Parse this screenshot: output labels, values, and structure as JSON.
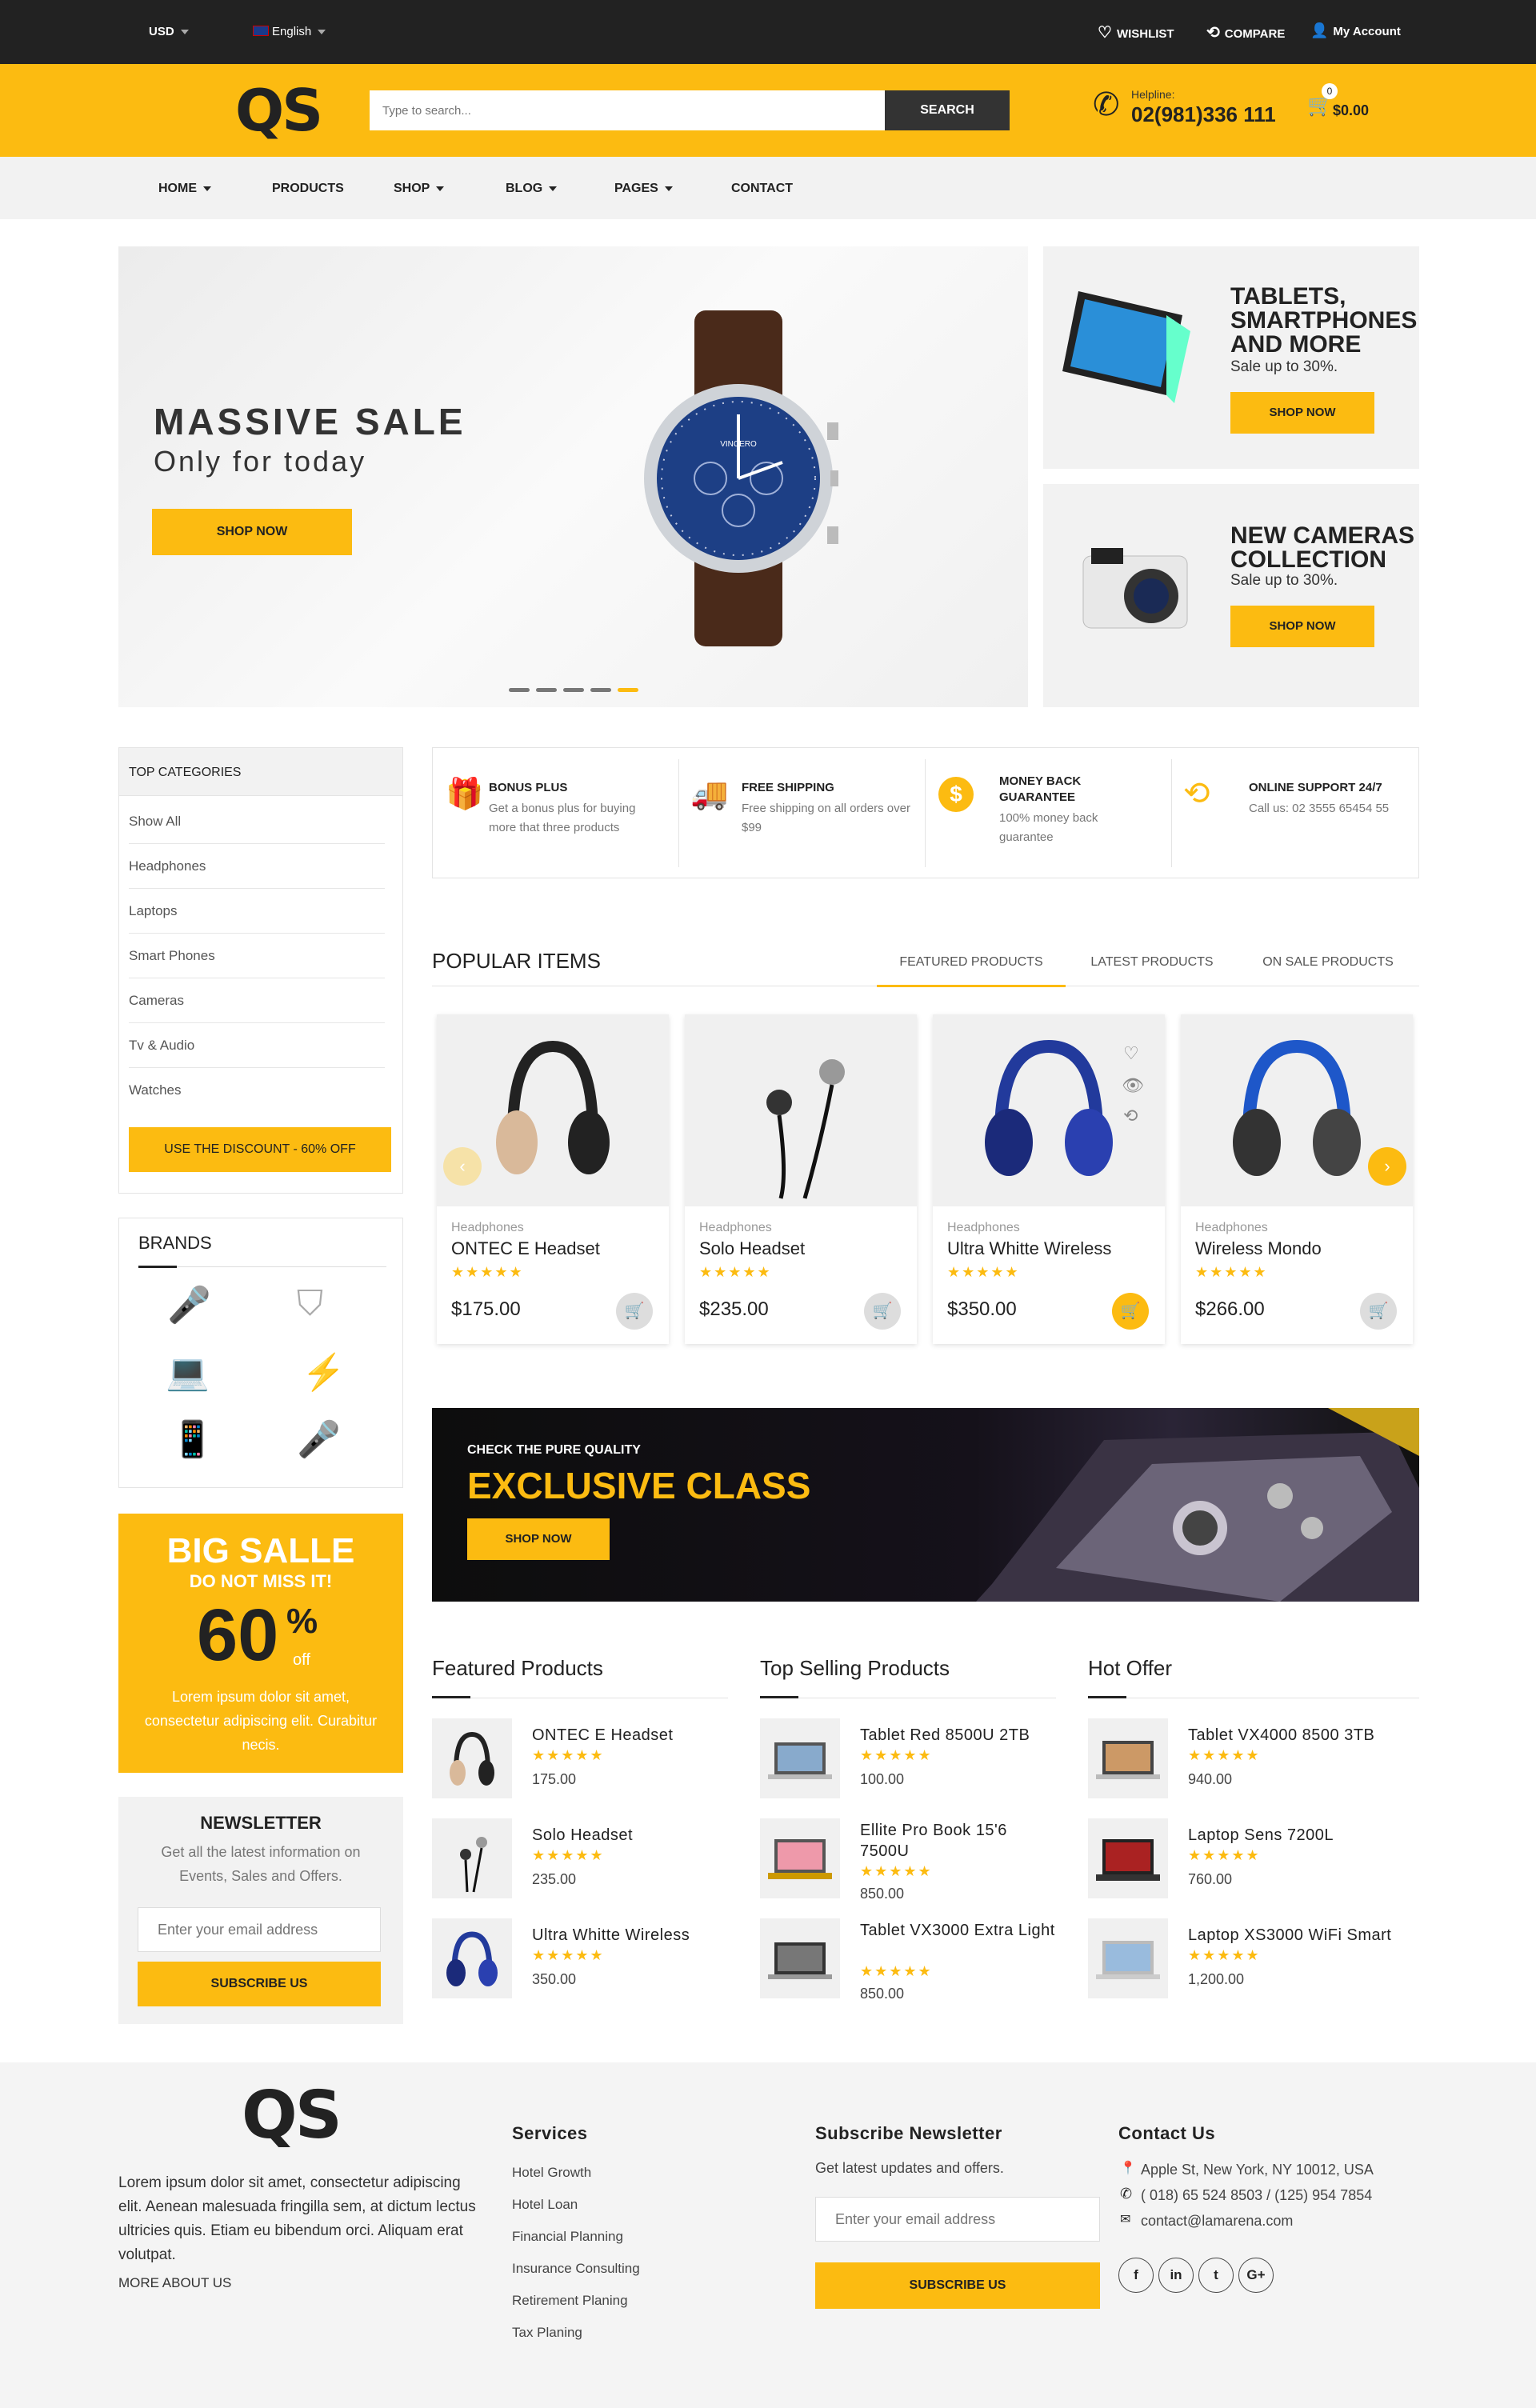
{
  "topbar": {
    "currency": "USD",
    "language": "English",
    "wishlist": "WISHLIST",
    "compare": "COMPARE",
    "account": "My Account"
  },
  "header": {
    "logo": "QS",
    "search_placeholder": "Type to search...",
    "search_button": "SEARCH",
    "helpline_label": "Helpline:",
    "helpline_number": "02(981)336 111",
    "cart_count": "0",
    "cart_total": "$0.00"
  },
  "nav": [
    "HOME",
    "PRODUCTS",
    "SHOP",
    "BLOG",
    "PAGES",
    "CONTACT"
  ],
  "hero": {
    "title": "MASSIVE SALE",
    "subtitle": "Only for today",
    "button": "SHOP NOW",
    "watch_brand": "VINCERO"
  },
  "side_banners": [
    {
      "title": "TABLETS, SMARTPHONES AND MORE",
      "sub": "Sale up to 30%.",
      "button": "SHOP NOW"
    },
    {
      "title": "NEW CAMERAS COLLECTION",
      "sub": "Sale up to 30%.",
      "button": "SHOP NOW"
    }
  ],
  "categories": {
    "title": "TOP CATEGORIES",
    "items": [
      "Show All",
      "Headphones",
      "Laptops",
      "Smart Phones",
      "Cameras",
      "Tv & Audio",
      "Watches"
    ],
    "button": "USE THE DISCOUNT - 60% OFF"
  },
  "brands": {
    "title": "BRANDS"
  },
  "features": [
    {
      "title": "BONUS PLUS",
      "desc": "Get a bonus plus for buying more that three products"
    },
    {
      "title": "FREE SHIPPING",
      "desc": "Free shipping on all orders over $99"
    },
    {
      "title": "MONEY BACK GUARANTEE",
      "desc": "100% money back guarantee"
    },
    {
      "title": "ONLINE SUPPORT 24/7",
      "desc": "Call us: 02 3555 65454 55"
    }
  ],
  "popular": {
    "title": "POPULAR ITEMS",
    "tabs": [
      "FEATURED PRODUCTS",
      "LATEST PRODUCTS",
      "ON SALE PRODUCTS"
    ],
    "products": [
      {
        "cat": "Headphones",
        "name": "ONTEC E Headset",
        "stars": "★★★★★",
        "price": "$175.00"
      },
      {
        "cat": "Headphones",
        "name": "Solo Headset",
        "stars": "★★★★★",
        "price": "$235.00"
      },
      {
        "cat": "Headphones",
        "name": "Ultra Whitte Wireless",
        "stars": "★★★★★",
        "price": "$350.00"
      },
      {
        "cat": "Headphones",
        "name": "Wireless Mondo",
        "stars": "★★★★★",
        "price": "$266.00"
      }
    ]
  },
  "promo": {
    "kicker": "CHECK THE PURE QUALITY",
    "title": "EXCLUSIVE CLASS",
    "button": "SHOP NOW"
  },
  "big_sale": {
    "title": "BIG SALLE",
    "sub": "DO NOT MISS IT!",
    "percent": "60",
    "pct": "%",
    "off": "off",
    "text": "Lorem ipsum dolor sit amet, consectetur adipiscing elit. Curabitur necis."
  },
  "newsletter_side": {
    "title": "NEWSLETTER",
    "text": "Get all the latest information on Events, Sales and Offers.",
    "placeholder": "Enter your email address",
    "button": "SUBSCRIBE US"
  },
  "lists": [
    {
      "title": "Featured Products",
      "items": [
        {
          "name": "ONTEC E Headset",
          "stars": "★★★★★",
          "price": "175.00"
        },
        {
          "name": "Solo Headset",
          "stars": "★★★★★",
          "price": "235.00"
        },
        {
          "name": "Ultra Whitte Wireless",
          "stars": "★★★★★",
          "price": "350.00"
        }
      ]
    },
    {
      "title": "Top Selling Products",
      "items": [
        {
          "name": "Tablet Red 8500U 2TB",
          "stars": "★★★★★",
          "price": "100.00"
        },
        {
          "name": "Ellite Pro Book 15'6 7500U",
          "stars": "★★★★★",
          "price": "850.00"
        },
        {
          "name": "Tablet VX3000 Extra Light",
          "stars": "★★★★★",
          "price": "850.00"
        }
      ]
    },
    {
      "title": "Hot Offer",
      "items": [
        {
          "name": "Tablet VX4000 8500 3TB",
          "stars": "★★★★★",
          "price": "940.00"
        },
        {
          "name": "Laptop Sens 7200L",
          "stars": "★★★★★",
          "price": "760.00"
        },
        {
          "name": "Laptop XS3000 WiFi Smart",
          "stars": "★★★★★",
          "price": "1,200.00"
        }
      ]
    }
  ],
  "footer": {
    "logo": "QS",
    "about": "Lorem ipsum dolor sit amet, consectetur adipiscing elit. Aenean malesuada fringilla sem, at dictum lectus ultricies quis. Etiam eu bibendum orci. Aliquam erat volutpat.",
    "more": "MORE ABOUT US",
    "services_title": "Services",
    "services": [
      "Hotel Growth",
      "Hotel Loan",
      "Financial Planning",
      "Insurance Consulting",
      "Retirement Planing",
      "Tax Planing"
    ],
    "subscribe_title": "Subscribe Newsletter",
    "subscribe_text": "Get latest updates and offers.",
    "subscribe_placeholder": "Enter your email address",
    "subscribe_button": "SUBSCRIBE US",
    "contact_title": "Contact Us",
    "address": "Apple St, New York, NY 10012, USA",
    "phone": "( 018) 65 524 8503 / (125) 954 7854",
    "email": "contact@lamarena.com",
    "social": [
      "f",
      "in",
      "t",
      "G+"
    ]
  }
}
